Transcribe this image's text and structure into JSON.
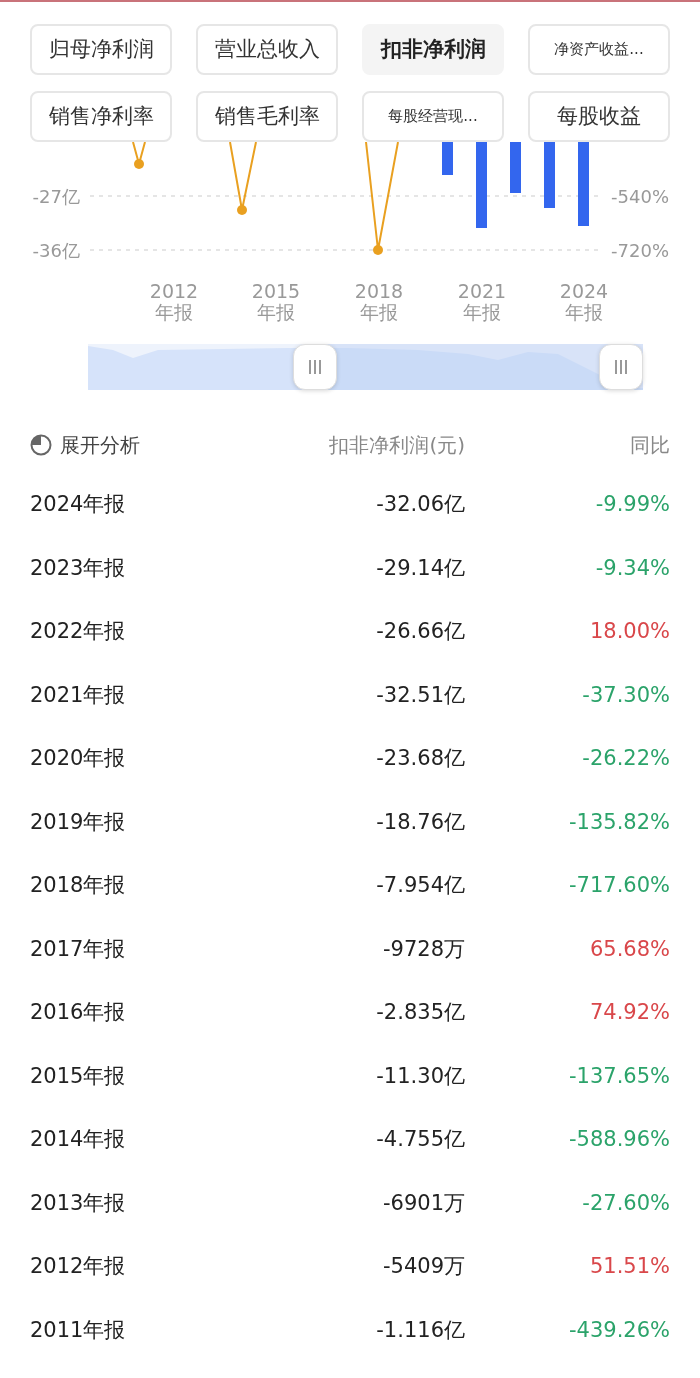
{
  "metric_tabs": [
    {
      "label": "归母净利润",
      "selected": false
    },
    {
      "label": "营业总收入",
      "selected": false
    },
    {
      "label": "扣非净利润",
      "selected": true
    },
    {
      "label": "净资产收益...",
      "selected": false
    },
    {
      "label": "销售净利率",
      "selected": false
    },
    {
      "label": "销售毛利率",
      "selected": false
    },
    {
      "label": "每股经营现...",
      "selected": false
    },
    {
      "label": "每股收益",
      "selected": false
    }
  ],
  "chart": {
    "left_ticks": [
      "-27亿",
      "-36亿"
    ],
    "right_ticks": [
      "-540%",
      "-720%"
    ],
    "x_labels": [
      {
        "year": "2012",
        "suffix": "年报"
      },
      {
        "year": "2015",
        "suffix": "年报"
      },
      {
        "year": "2018",
        "suffix": "年报"
      },
      {
        "year": "2021",
        "suffix": "年报"
      },
      {
        "year": "2024",
        "suffix": "年报"
      }
    ]
  },
  "table": {
    "analysis_label": "展开分析",
    "value_header": "扣非净利润(元)",
    "yoy_header": "同比",
    "rows": [
      {
        "period": "2024年报",
        "value": "-32.06亿",
        "yoy": "-9.99%",
        "kind": "down"
      },
      {
        "period": "2023年报",
        "value": "-29.14亿",
        "yoy": "-9.34%",
        "kind": "down"
      },
      {
        "period": "2022年报",
        "value": "-26.66亿",
        "yoy": "18.00%",
        "kind": "up"
      },
      {
        "period": "2021年报",
        "value": "-32.51亿",
        "yoy": "-37.30%",
        "kind": "down"
      },
      {
        "period": "2020年报",
        "value": "-23.68亿",
        "yoy": "-26.22%",
        "kind": "down"
      },
      {
        "period": "2019年报",
        "value": "-18.76亿",
        "yoy": "-135.82%",
        "kind": "down"
      },
      {
        "period": "2018年报",
        "value": "-7.954亿",
        "yoy": "-717.60%",
        "kind": "down"
      },
      {
        "period": "2017年报",
        "value": "-9728万",
        "yoy": "65.68%",
        "kind": "up"
      },
      {
        "period": "2016年报",
        "value": "-2.835亿",
        "yoy": "74.92%",
        "kind": "up"
      },
      {
        "period": "2015年报",
        "value": "-11.30亿",
        "yoy": "-137.65%",
        "kind": "down"
      },
      {
        "period": "2014年报",
        "value": "-4.755亿",
        "yoy": "-588.96%",
        "kind": "down"
      },
      {
        "period": "2013年报",
        "value": "-6901万",
        "yoy": "-27.60%",
        "kind": "down"
      },
      {
        "period": "2012年报",
        "value": "-5409万",
        "yoy": "51.51%",
        "kind": "up"
      },
      {
        "period": "2011年报",
        "value": "-1.116亿",
        "yoy": "-439.26%",
        "kind": "down"
      }
    ]
  }
}
